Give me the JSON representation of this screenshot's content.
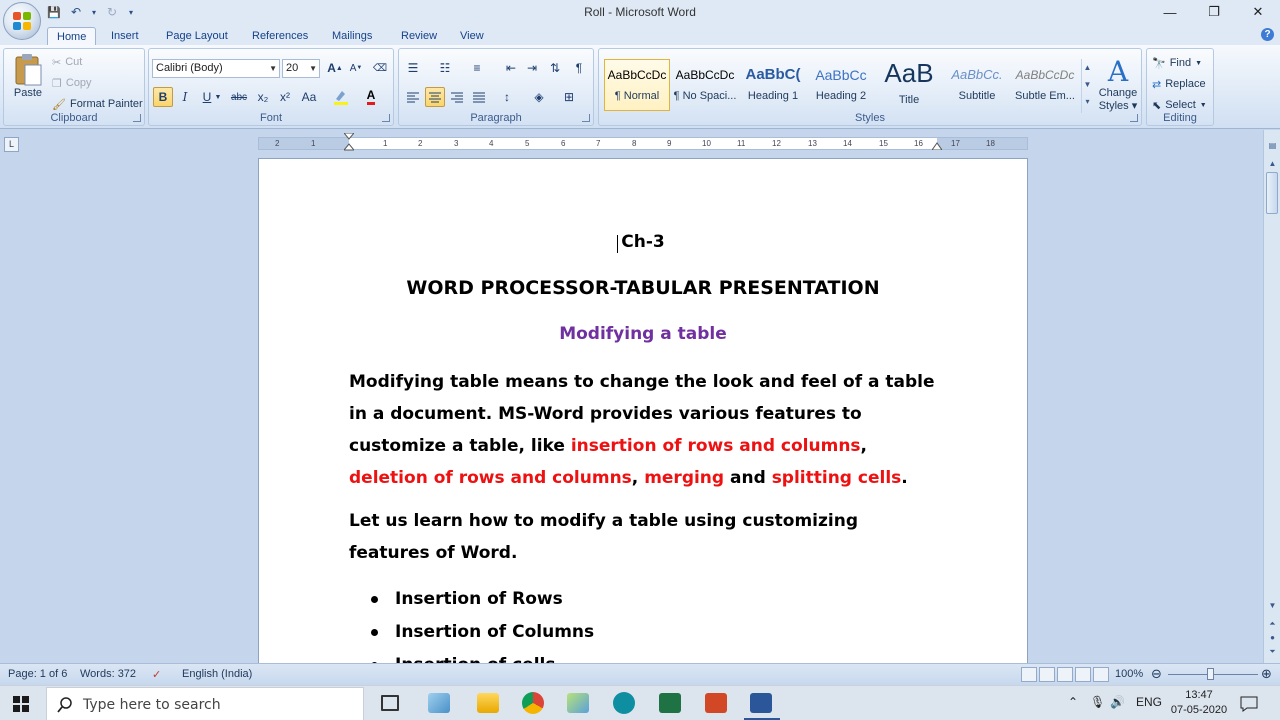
{
  "window": {
    "title": "Roll - Microsoft Word",
    "minimize": "—",
    "maximize": "❐",
    "close": "✕"
  },
  "qat": {
    "save": "💾",
    "undo": "↶",
    "redo": "↻",
    "more": "▾"
  },
  "tabs": [
    "Home",
    "Insert",
    "Page Layout",
    "References",
    "Mailings",
    "Review",
    "View"
  ],
  "help": "?",
  "clipboard": {
    "label": "Clipboard",
    "paste": "Paste",
    "cut": "Cut",
    "copy": "Copy",
    "format_painter": "Format Painter"
  },
  "font": {
    "label": "Font",
    "family": "Calibri (Body)",
    "size": "20",
    "bold": "B",
    "italic": "I",
    "underline": "U",
    "strike": "abc",
    "subscript": "x₂",
    "superscript": "x²",
    "change_case": "Aa",
    "grow": "A",
    "shrink": "A"
  },
  "paragraph": {
    "label": "Paragraph",
    "pilcrow": "¶"
  },
  "styles": {
    "label": "Styles",
    "items": [
      {
        "preview": "AaBbCcDc",
        "name": "¶ Normal"
      },
      {
        "preview": "AaBbCcDc",
        "name": "¶ No Spaci..."
      },
      {
        "preview": "AaBbC(",
        "name": "Heading 1"
      },
      {
        "preview": "AaBbCc",
        "name": "Heading 2"
      },
      {
        "preview": "AaB",
        "name": "Title"
      },
      {
        "preview": "AaBbCc.",
        "name": "Subtitle"
      },
      {
        "preview": "AaBbCcDc",
        "name": "Subtle Em..."
      }
    ],
    "change_styles_1": "Change",
    "change_styles_2": "Styles"
  },
  "editing": {
    "label": "Editing",
    "find": "Find",
    "replace": "Replace",
    "select": "Select"
  },
  "ruler": {
    "corner": "L",
    "ticks": [
      "2",
      "1",
      "1",
      "2",
      "3",
      "4",
      "5",
      "6",
      "7",
      "8",
      "9",
      "10",
      "11",
      "12",
      "13",
      "14",
      "15",
      "16",
      "17",
      "18"
    ]
  },
  "document": {
    "chapter": "Ch-3",
    "title": "WORD PROCESSOR-TABULAR PRESENTATION",
    "subtitle": "Modifying a table",
    "p1_a": "Modifying table means to change the look and feel of a table in a document. MS-Word provides various features to customize a table, like ",
    "p1_r1": "insertion of rows and columns",
    "p1_s1": ", ",
    "p1_r2": "deletion of rows and columns",
    "p1_s2": ", ",
    "p1_r3": "merging",
    "p1_s3": " and ",
    "p1_r4": "splitting cells",
    "p1_end": ".",
    "p2": "Let us learn how to modify a table using customizing features of Word.",
    "bullets": [
      "Insertion of Rows",
      "Insertion of Columns",
      "Insertion of cells"
    ]
  },
  "status": {
    "page": "Page: 1 of 6",
    "words": "Words: 372",
    "language": "English (India)",
    "zoom": "100%"
  },
  "taskbar": {
    "search_placeholder": "Type here to search",
    "language": "ENG",
    "time": "13:47",
    "date": "07-05-2020"
  },
  "colors": {
    "accent_red": "#ee1111",
    "subtitle_purple": "#7030a0",
    "ribbon_bg": "#dbe7f5"
  }
}
